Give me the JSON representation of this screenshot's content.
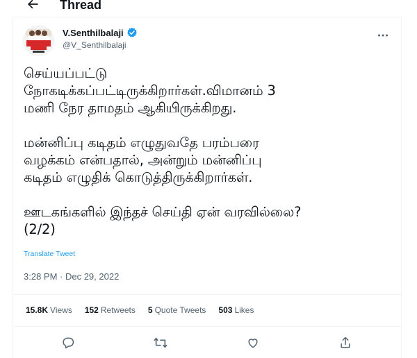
{
  "header": {
    "title": "Thread",
    "back_icon": "arrow-left-icon"
  },
  "tweet": {
    "author_name": "V.Senthilbalaji",
    "author_handle": "@V_Senthilbalaji",
    "verified": true,
    "accent_color": "#1d9bf0",
    "lines": [
      "செய்யப்பட்டு",
      "நோகடிக்கப்பட்டிருக்கிறார்கள்.விமானம் 3",
      "மணி நேர தாமதம் ஆகியிருக்கிறது.",
      "",
      "மன்னிப்பு கடிதம் எழுதுவதே பரம்பரை",
      "வழக்கம் என்பதால்,  அன்றும் மன்னிப்பு",
      "கடிதம் எழுதிக் கொடுத்திருக்கிறார்கள்.",
      "",
      "ஊடகங்களில் இந்தச் செய்தி ஏன் வரவில்லை?",
      "(2/2)"
    ],
    "translate_label": "Translate Tweet",
    "timestamp": "3:28 PM · Dec 29, 2022"
  },
  "stats": {
    "views_count": "15.8K",
    "views_label": "Views",
    "retweets_count": "152",
    "retweets_label": "Retweets",
    "quotes_count": "5",
    "quotes_label": "Quote Tweets",
    "likes_count": "503",
    "likes_label": "Likes"
  },
  "actions": [
    "reply-icon",
    "retweet-icon",
    "like-icon",
    "share-icon"
  ]
}
